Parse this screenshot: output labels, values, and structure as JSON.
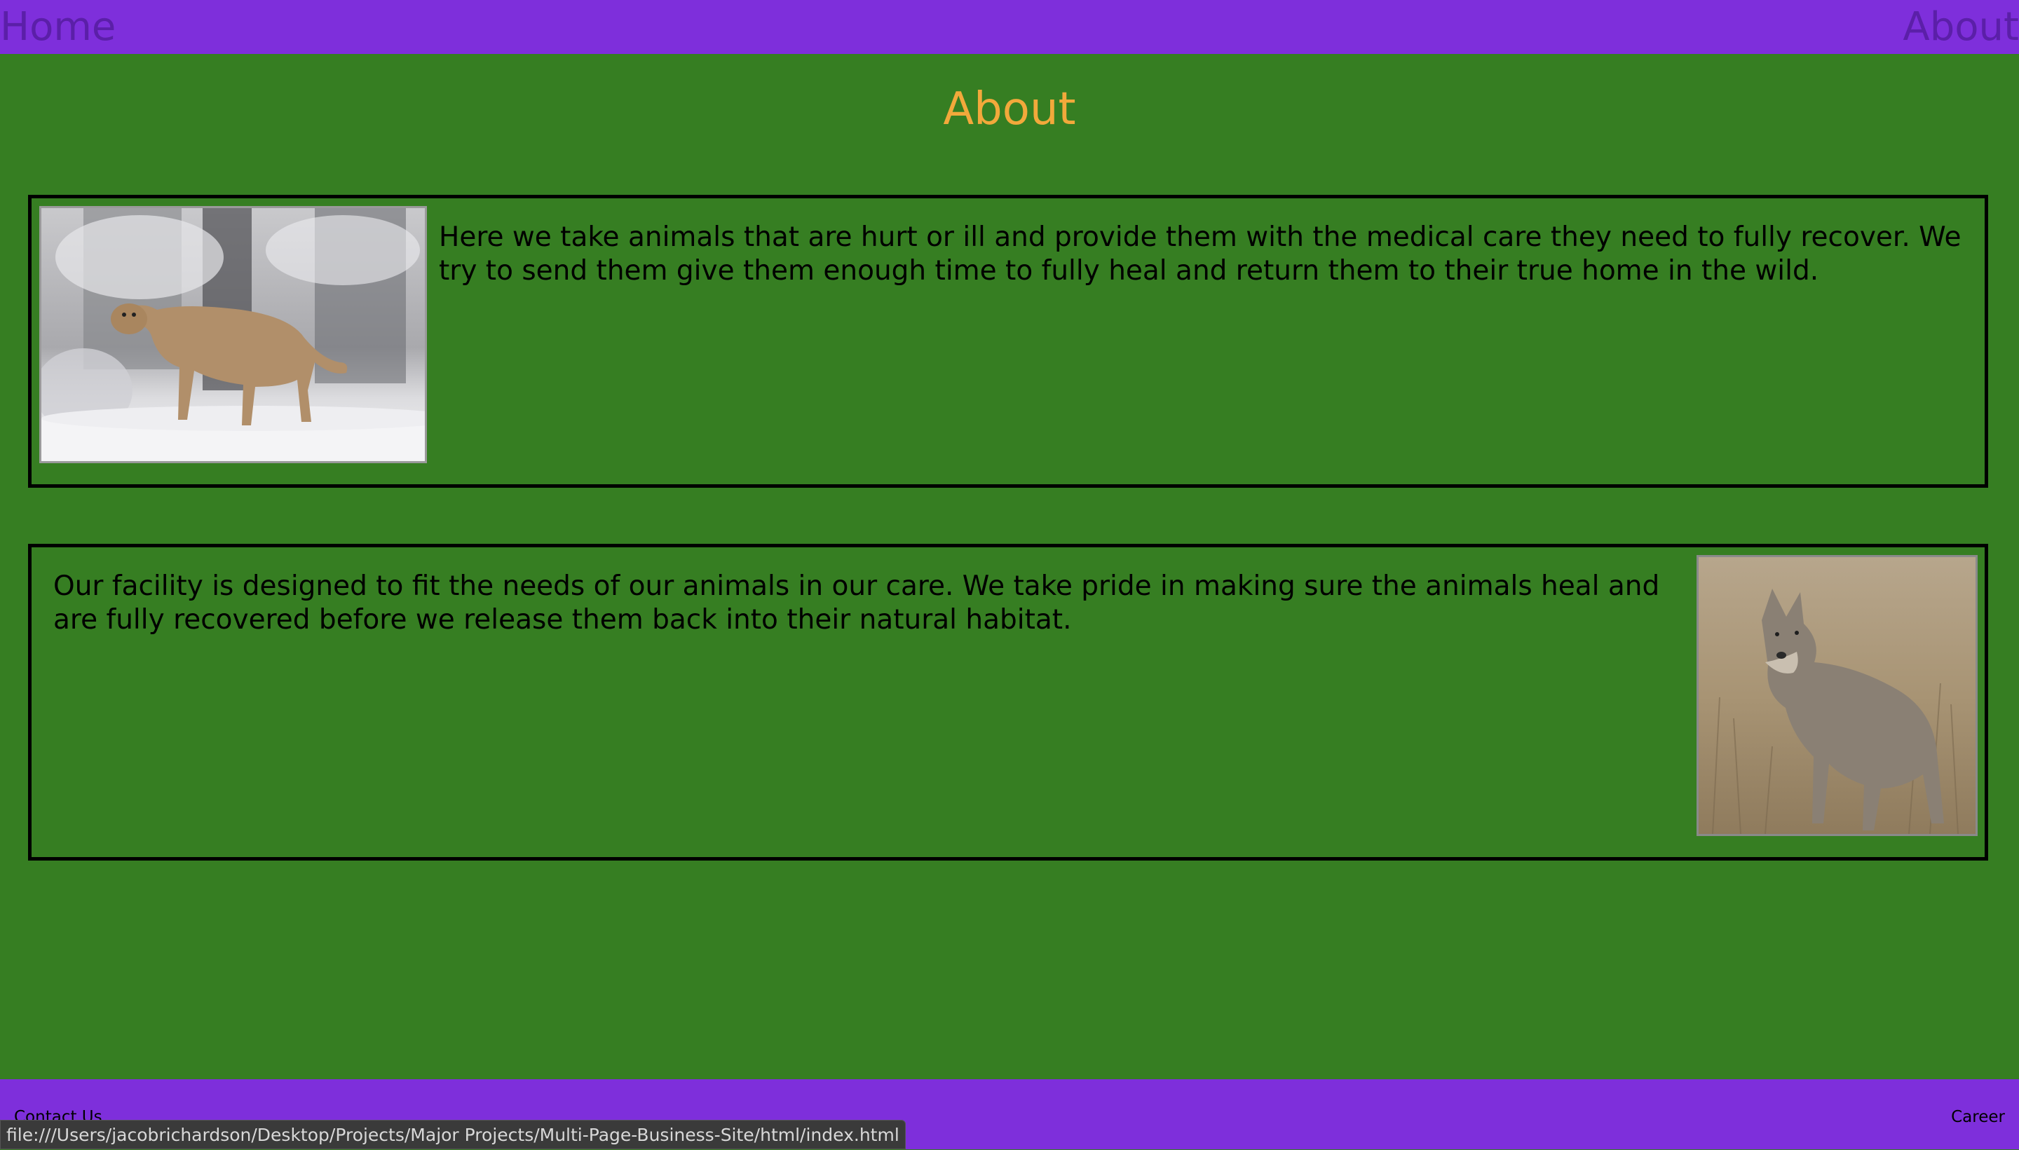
{
  "nav": {
    "home_label": "Home",
    "about_label": "About"
  },
  "main": {
    "title": "About",
    "cards": [
      {
        "image_name": "cougar-in-snow-photo",
        "text": "Here we take animals that are hurt or ill and provide them with the medical care they need to fully recover. We try to send them give them enough time to fully heal and return them to their true home in the wild."
      },
      {
        "image_name": "coyote-in-grass-photo",
        "text": "Our facility is designed to fit the needs of our animals in our care. We take pride in making sure the animals heal and are fully recovered before we release them back into their natural habitat."
      }
    ]
  },
  "footer": {
    "contact_label": "Contact Us",
    "career_label": "Career"
  },
  "status_bar": {
    "url": "file:///Users/jacobrichardson/Desktop/Projects/Major Projects/Multi-Page-Business-Site/html/index.html"
  },
  "colors": {
    "background": "#367e22",
    "nav_background": "#7e2fdb",
    "nav_text": "#5b1fa8",
    "title": "#f2a93b"
  }
}
